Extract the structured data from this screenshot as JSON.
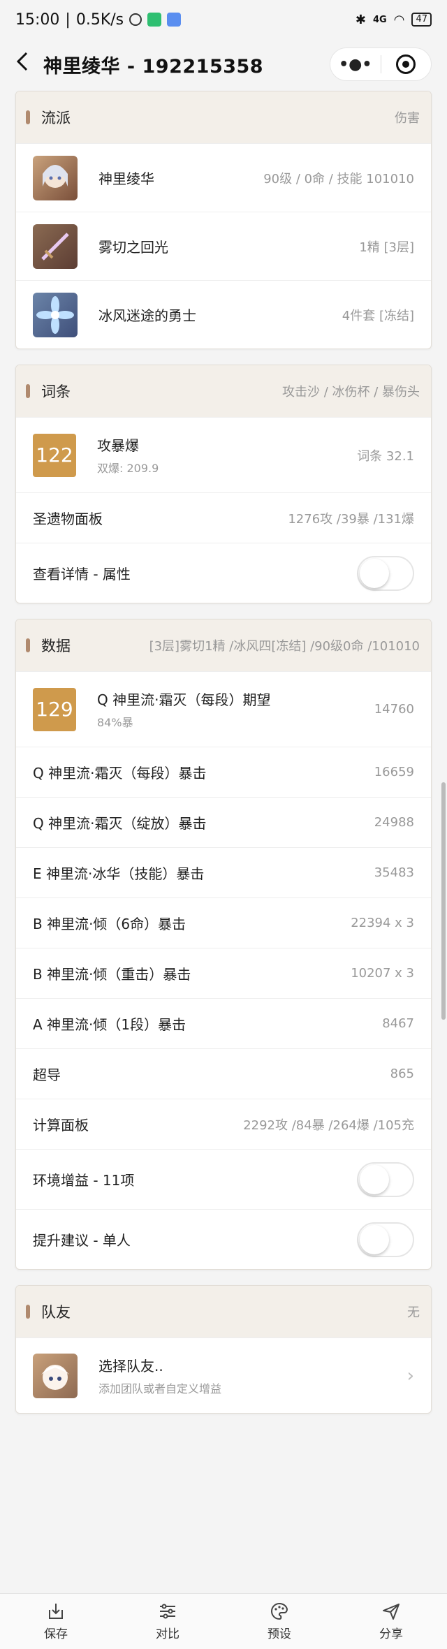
{
  "statusbar": {
    "time": "15:00",
    "speed": "0.5K/s",
    "signal": "4G",
    "battery": "47"
  },
  "nav": {
    "title": "神里绫华 - 192215358"
  },
  "build": {
    "title": "流派",
    "extra": "伤害",
    "items": [
      {
        "name": "神里绫华",
        "value": "90级 / 0命 / 技能 101010",
        "icon": "character-avatar"
      },
      {
        "name": "雾切之回光",
        "value": "1精 [3层]",
        "icon": "weapon-sword"
      },
      {
        "name": "冰风迷途的勇士",
        "value": "4件套 [冻结]",
        "icon": "artifact-flower"
      }
    ]
  },
  "substats": {
    "title": "词条",
    "extra": "攻击沙 / 冰伤杯 / 暴伤头",
    "score": "122",
    "score_label": "攻暴爆",
    "score_sub": "双爆: 209.9",
    "score_value": "词条 32.1",
    "panel_label": "圣遗物面板",
    "panel_value": "1276攻 /39暴 /131爆",
    "detail_label": "查看详情 - 属性"
  },
  "damage": {
    "title": "数据",
    "extra": "[3层]雾切1精 /冰风四[冻结] /90级0命 /101010",
    "score": "129",
    "score_label": "Q 神里流·霜灭（每段）期望",
    "score_sub": "84%暴",
    "score_value": "14760",
    "rows": [
      {
        "label": "Q 神里流·霜灭（每段）暴击",
        "value": "16659"
      },
      {
        "label": "Q 神里流·霜灭（绽放）暴击",
        "value": "24988"
      },
      {
        "label": "E 神里流·冰华（技能）暴击",
        "value": "35483"
      },
      {
        "label": "B 神里流·倾（6命）暴击",
        "value": "22394 x 3"
      },
      {
        "label": "B 神里流·倾（重击）暴击",
        "value": "10207 x 3"
      },
      {
        "label": "A 神里流·倾（1段）暴击",
        "value": "8467"
      },
      {
        "label": "超导",
        "value": "865"
      },
      {
        "label": "计算面板",
        "value": "2292攻 /84暴 /264爆 /105充"
      }
    ],
    "env_label": "环境增益 - 11项",
    "suggest_label": "提升建议 - 单人"
  },
  "team": {
    "title": "队友",
    "extra": "无",
    "select_label": "选择队友..",
    "select_sub": "添加团队或者自定义增益"
  },
  "tabs": [
    {
      "label": "保存",
      "icon": "save-icon"
    },
    {
      "label": "对比",
      "icon": "sliders-icon"
    },
    {
      "label": "预设",
      "icon": "palette-icon"
    },
    {
      "label": "分享",
      "icon": "send-icon"
    }
  ],
  "colors": {
    "accent_bar": "#b08a6e",
    "score_bg": "#cf9a4c",
    "header_bg": "#f3efe9"
  }
}
